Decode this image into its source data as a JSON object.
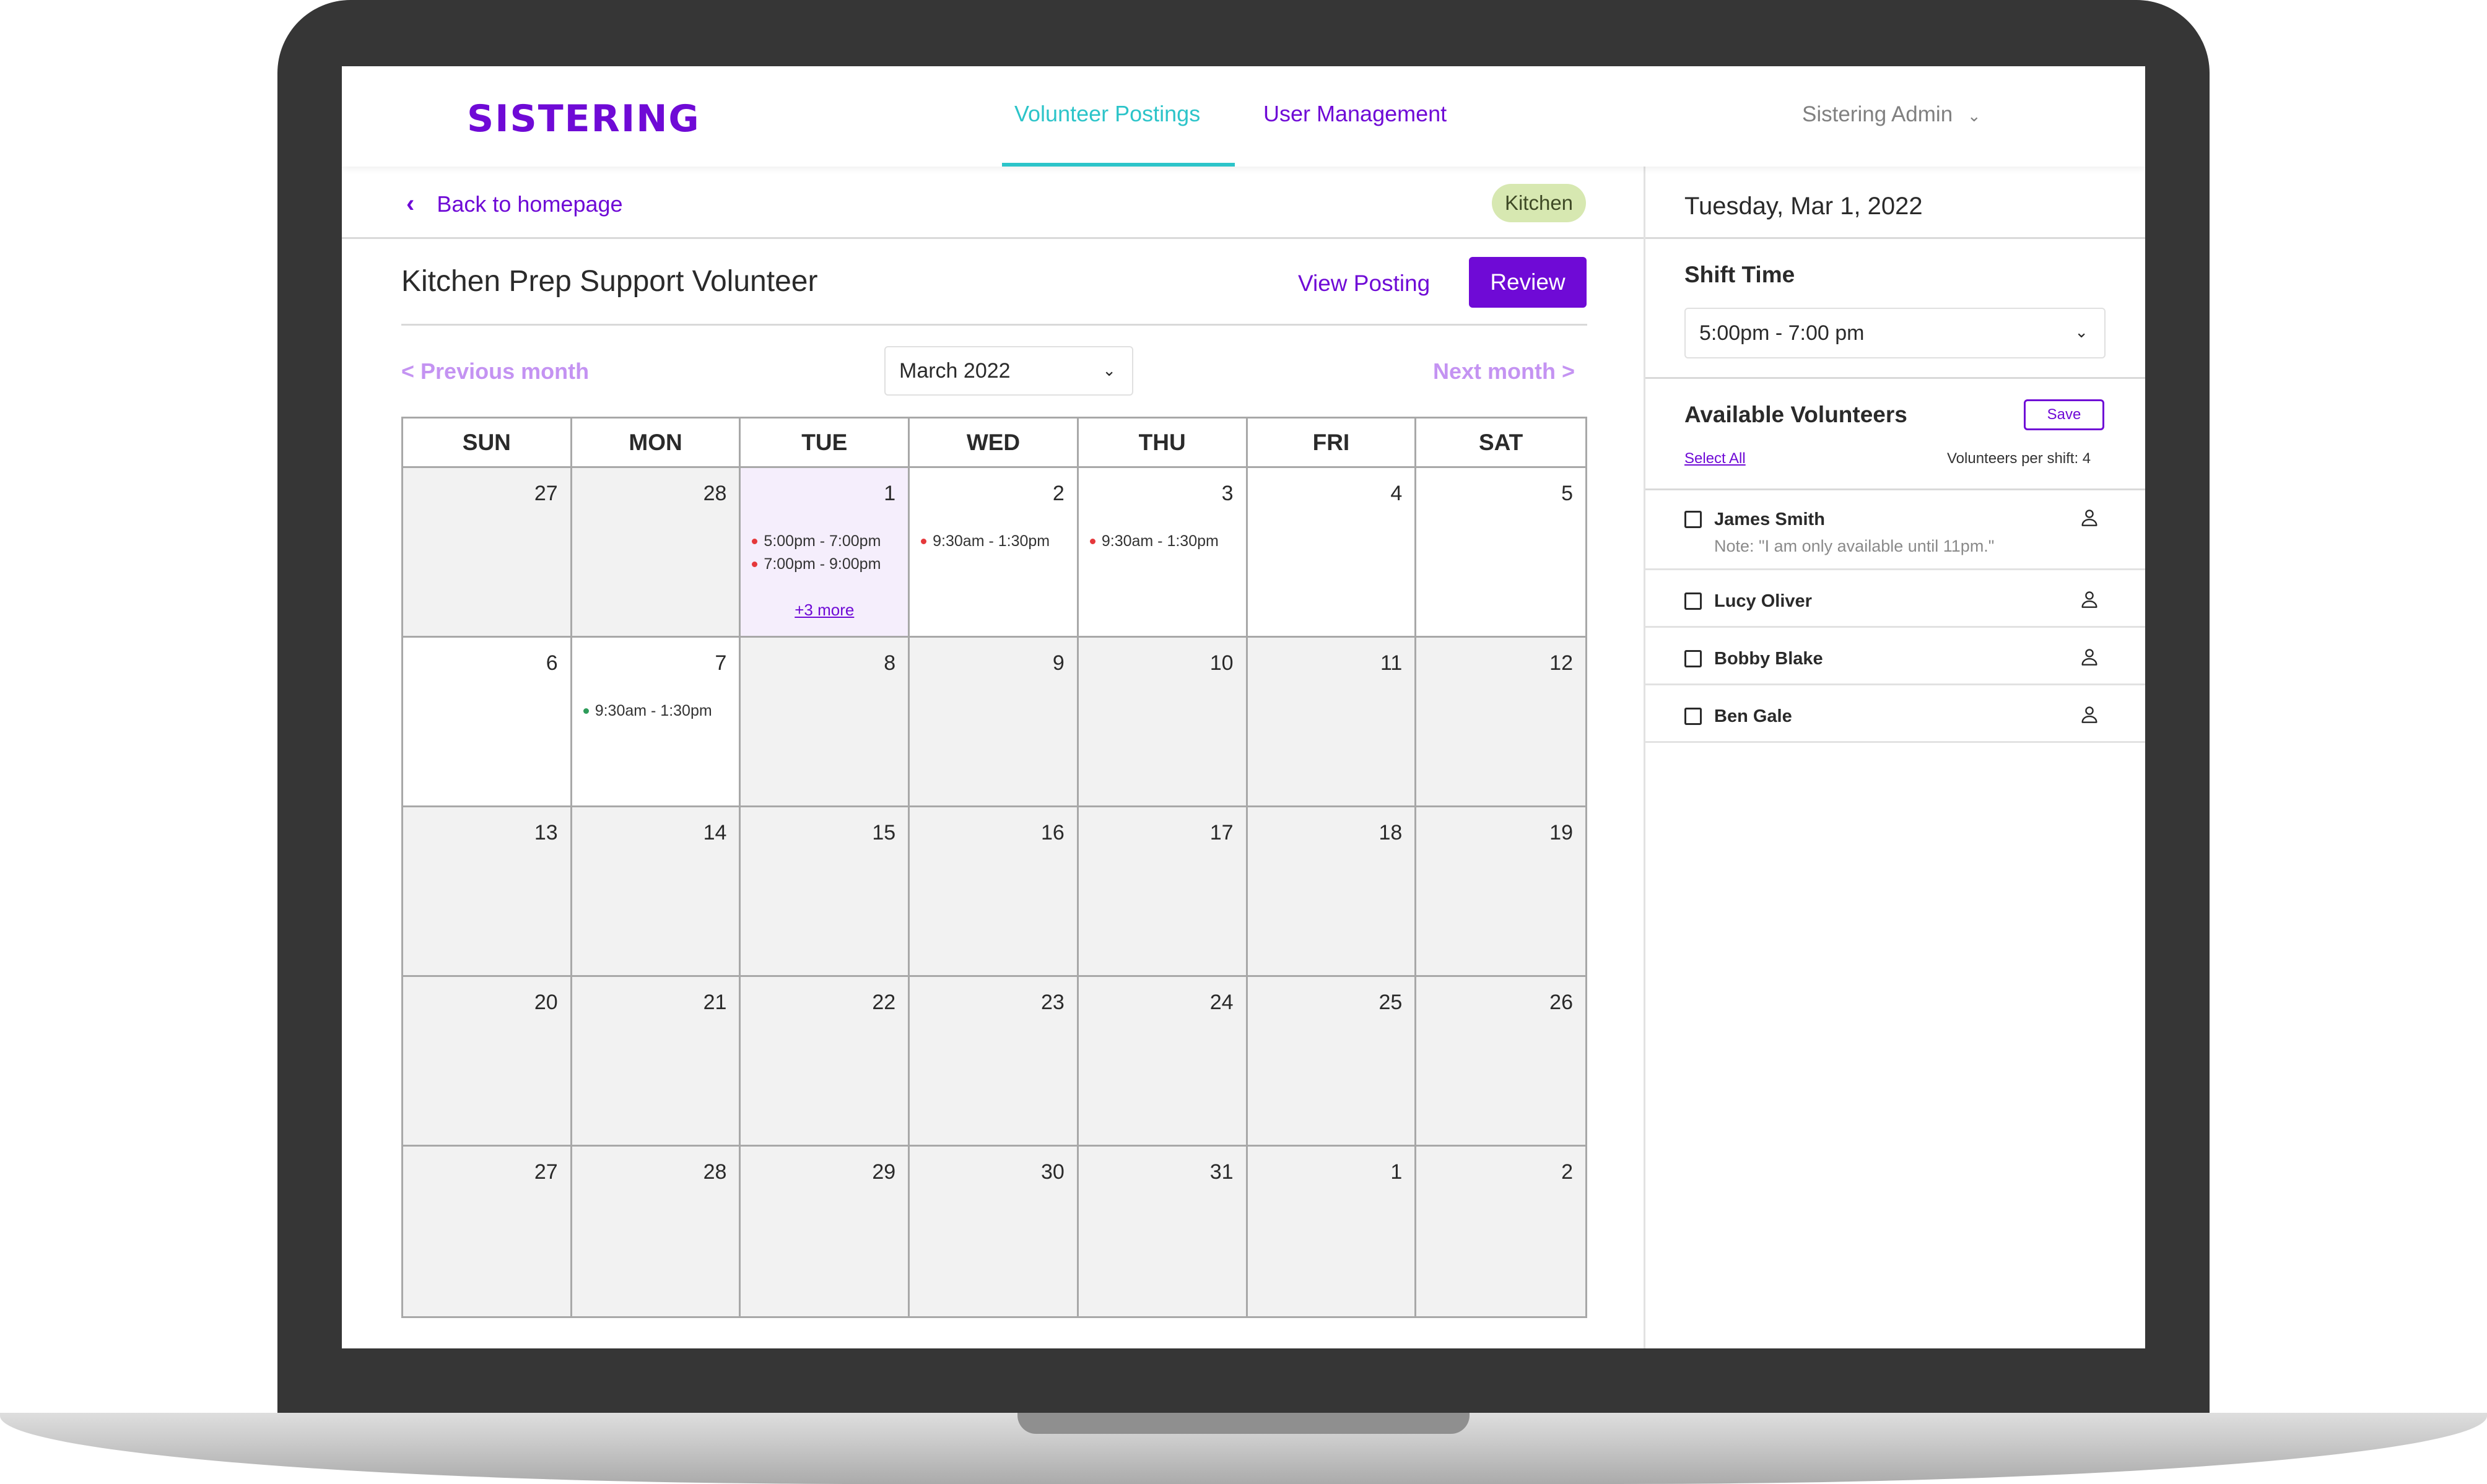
{
  "header": {
    "logo": "SISTERING",
    "nav": [
      {
        "label": "Volunteer Postings",
        "active": true
      },
      {
        "label": "User Management",
        "active": false
      }
    ],
    "user_menu": "Sistering Admin"
  },
  "posting": {
    "back_label": "Back to homepage",
    "tag": "Kitchen",
    "title": "Kitchen Prep Support Volunteer",
    "view_posting_label": "View Posting",
    "review_label": "Review"
  },
  "calendar": {
    "prev_month": "< Previous month",
    "next_month": "Next month >",
    "selected_month": "March 2022",
    "days_of_week": [
      "SUN",
      "MON",
      "TUE",
      "WED",
      "THU",
      "FRI",
      "SAT"
    ],
    "weeks": [
      [
        {
          "day": "27",
          "current": false
        },
        {
          "day": "28",
          "current": false
        },
        {
          "day": "1",
          "current": true,
          "selected": true,
          "shifts": [
            {
              "time": "5:00pm - 7:00pm",
              "color": "#e5383b"
            },
            {
              "time": "7:00pm - 9:00pm",
              "color": "#e5383b"
            }
          ],
          "more": "+3 more"
        },
        {
          "day": "2",
          "current": true,
          "shifts": [
            {
              "time": "9:30am - 1:30pm",
              "color": "#e5383b"
            }
          ]
        },
        {
          "day": "3",
          "current": true,
          "shifts": [
            {
              "time": "9:30am - 1:30pm",
              "color": "#e5383b"
            }
          ]
        },
        {
          "day": "4",
          "current": true
        },
        {
          "day": "5",
          "current": true
        }
      ],
      [
        {
          "day": "6",
          "current": true
        },
        {
          "day": "7",
          "current": true,
          "shifts": [
            {
              "time": "9:30am - 1:30pm",
              "color": "#2e9c5a"
            }
          ]
        },
        {
          "day": "8",
          "current": false
        },
        {
          "day": "9",
          "current": false
        },
        {
          "day": "10",
          "current": false
        },
        {
          "day": "11",
          "current": false
        },
        {
          "day": "12",
          "current": false
        }
      ],
      [
        {
          "day": "13",
          "current": false
        },
        {
          "day": "14",
          "current": false
        },
        {
          "day": "15",
          "current": false
        },
        {
          "day": "16",
          "current": false
        },
        {
          "day": "17",
          "current": false
        },
        {
          "day": "18",
          "current": false
        },
        {
          "day": "19",
          "current": false
        }
      ],
      [
        {
          "day": "20",
          "current": false
        },
        {
          "day": "21",
          "current": false
        },
        {
          "day": "22",
          "current": false
        },
        {
          "day": "23",
          "current": false
        },
        {
          "day": "24",
          "current": false
        },
        {
          "day": "25",
          "current": false
        },
        {
          "day": "26",
          "current": false
        }
      ],
      [
        {
          "day": "27",
          "current": false
        },
        {
          "day": "28",
          "current": false
        },
        {
          "day": "29",
          "current": false
        },
        {
          "day": "30",
          "current": false
        },
        {
          "day": "31",
          "current": false
        },
        {
          "day": "1",
          "current": false
        },
        {
          "day": "2",
          "current": false
        }
      ]
    ]
  },
  "sidebar": {
    "date": "Tuesday, Mar 1, 2022",
    "shift_time_label": "Shift Time",
    "shift_time_value": "5:00pm - 7:00 pm",
    "available_label": "Available Volunteers",
    "save_label": "Save",
    "select_all_label": "Select All",
    "per_shift": "Volunteers per shift: 4",
    "volunteers": [
      {
        "name": "James Smith",
        "note": "Note: \"I am only available until 11pm.\""
      },
      {
        "name": "Lucy Oliver",
        "note": ""
      },
      {
        "name": "Bobby Blake",
        "note": ""
      },
      {
        "name": "Ben Gale",
        "note": ""
      }
    ]
  },
  "icons": {
    "back": "chevron-left-icon",
    "dropdown": "chevron-down-icon",
    "volunteer": "user-icon"
  },
  "colors": {
    "brand": "#6f0ad6",
    "accent": "#2cc4c9",
    "tag_bg": "#d7e8b1"
  }
}
